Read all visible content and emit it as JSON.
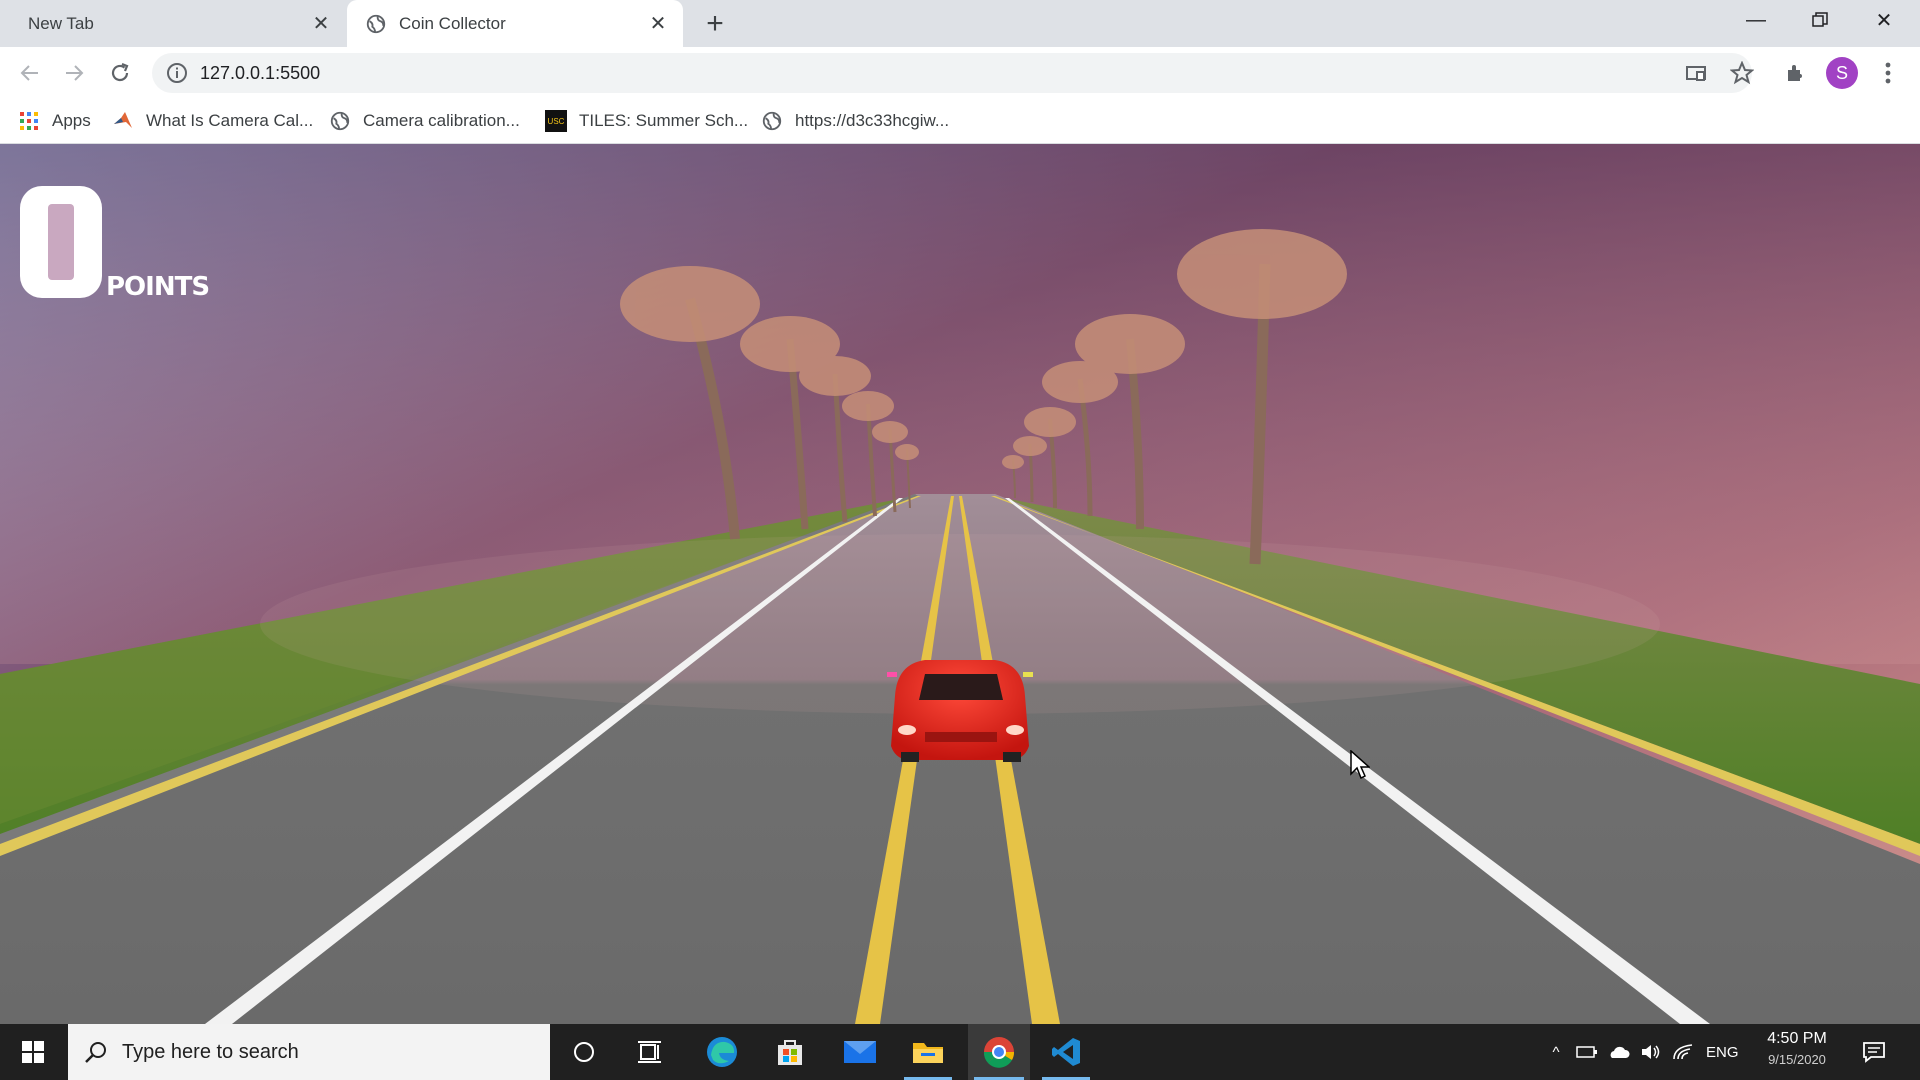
{
  "browser": {
    "tabs": [
      {
        "title": "New Tab",
        "active": false
      },
      {
        "title": "Coin Collector",
        "active": true
      }
    ],
    "url": "127.0.0.1:5500",
    "profile_initial": "S",
    "bookmarks": [
      {
        "label": "Apps",
        "icon": "apps-grid-icon"
      },
      {
        "label": "What Is Camera Cal...",
        "icon": "matlab-icon"
      },
      {
        "label": "Camera calibration...",
        "icon": "globe-icon"
      },
      {
        "label": "TILES: Summer Sch...",
        "icon": "usc-icon"
      },
      {
        "label": "https://d3c33hcgiw...",
        "icon": "globe-icon"
      }
    ]
  },
  "game": {
    "score": "0",
    "score_label": "POINTS",
    "colors": {
      "sky_top": "#7a4a6a",
      "sky_bottom": "#c27f88",
      "grass": "#5f8a2a",
      "road": "#6e6e6e",
      "car": "#e0231a",
      "center_line": "#e0c040"
    }
  },
  "taskbar": {
    "search_placeholder": "Type here to search",
    "language": "ENG",
    "time": "4:50 PM",
    "date": "9/15/2020",
    "apps": [
      "cortana-icon",
      "task-view-icon",
      "edge-icon",
      "store-icon",
      "mail-icon",
      "file-explorer-icon",
      "chrome-icon",
      "vscode-icon"
    ]
  }
}
